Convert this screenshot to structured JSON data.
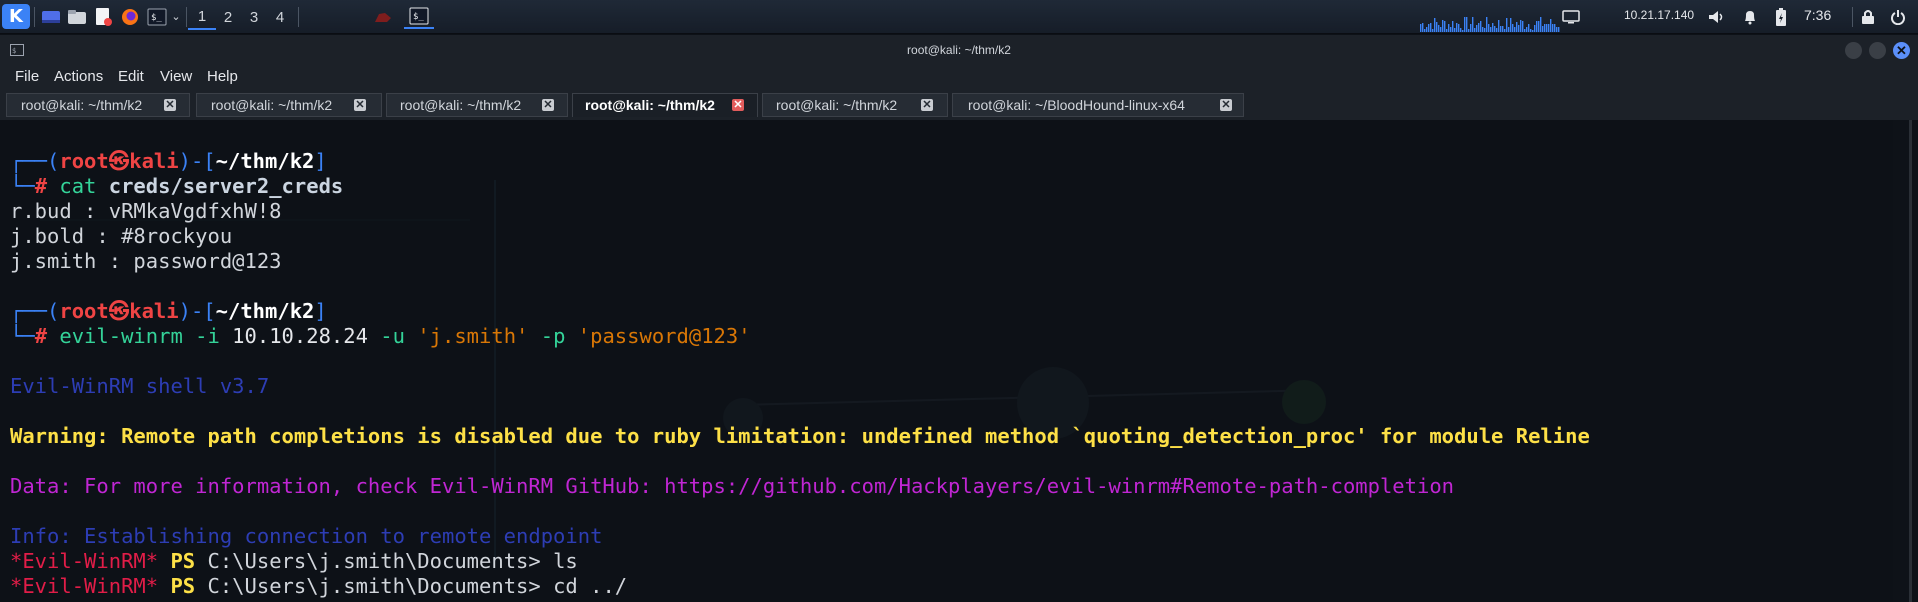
{
  "panel": {
    "workspaces": [
      "1",
      "2",
      "3",
      "4"
    ],
    "active_workspace": "1",
    "ip": "10.21.17.140",
    "time": "7:36"
  },
  "window": {
    "title": "root@kali: ~/thm/k2"
  },
  "menu": [
    "File",
    "Actions",
    "Edit",
    "View",
    "Help"
  ],
  "tabs": [
    {
      "label": "root@kali: ~/thm/k2",
      "active": false
    },
    {
      "label": "root@kali: ~/thm/k2",
      "active": false
    },
    {
      "label": "root@kali: ~/thm/k2",
      "active": false
    },
    {
      "label": "root@kali: ~/thm/k2",
      "active": true
    },
    {
      "label": "root@kali: ~/thm/k2",
      "active": false
    },
    {
      "label": "root@kali: ~/BloodHound-linux-x64",
      "active": false
    }
  ],
  "terminal": {
    "prompt1": {
      "user": "root",
      "sep": "㉿",
      "host": "kali",
      "path": "~/thm/k2"
    },
    "cmd1": {
      "name": "cat",
      "arg": "creds/server2_creds"
    },
    "creds": [
      "r.bud : vRMkaVgdfxhW!8",
      "j.bold : #8rockyou",
      "j.smith : password@123"
    ],
    "prompt2": {
      "user": "root",
      "sep": "㉿",
      "host": "kali",
      "path": "~/thm/k2"
    },
    "cmd2": {
      "name": "evil-winrm",
      "flag_i": "-i",
      "ip": "10.10.28.24",
      "flag_u": "-u",
      "user": "'j.smith'",
      "flag_p": "-p",
      "pass": "'password@123'"
    },
    "banner": "Evil-WinRM shell v3.7",
    "warning": "Warning: Remote path completions is disabled due to ruby limitation: undefined method `quoting_detection_proc' for module Reline",
    "data_line": "Data: For more information, check Evil-WinRM GitHub: https://github.com/Hackplayers/evil-winrm#Remote-path-completion",
    "info_line": "Info: Establishing connection to remote endpoint",
    "ps_lines": [
      {
        "tag": "*Evil-WinRM*",
        "ps": "PS",
        "cwd": "C:\\Users\\j.smith\\Documents>",
        "cmd": "ls"
      },
      {
        "tag": "*Evil-WinRM*",
        "ps": "PS",
        "cwd": "C:\\Users\\j.smith\\Documents>",
        "cmd": "cd ../"
      }
    ]
  },
  "colors": {
    "prompt_box": "#3b82f6",
    "root_red": "#ef4444",
    "command_green": "#34d399",
    "string_orange": "#d97706",
    "warning_yellow": "#fde047",
    "data_magenta": "#c026d3",
    "info_blue": "#2d3db4"
  }
}
